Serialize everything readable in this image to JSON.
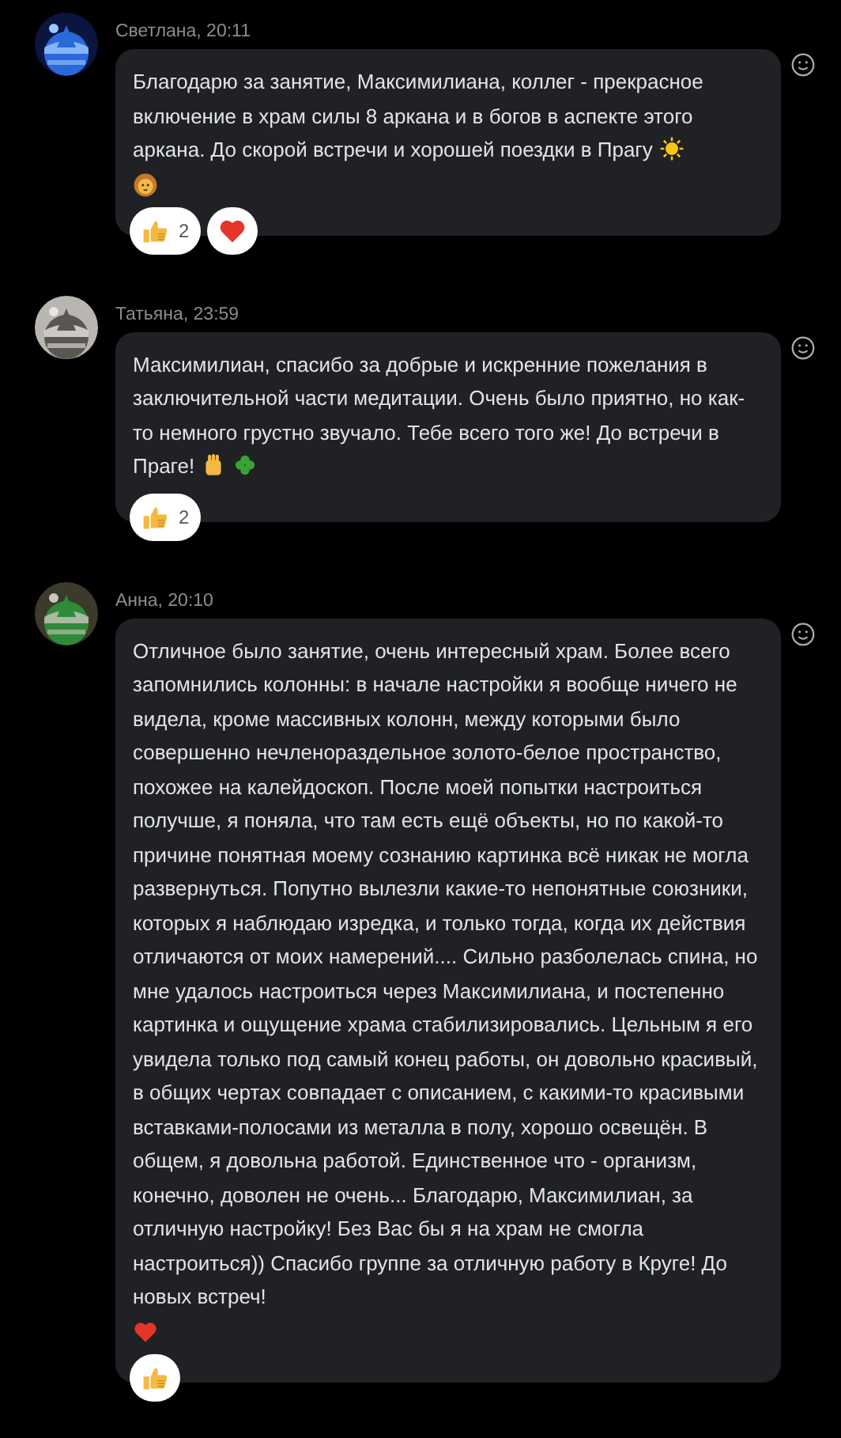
{
  "messages": [
    {
      "author": "Светлана, 20:11",
      "avatar": {
        "kind": "picture"
      },
      "text": "Благодарю за занятие, Максимилиана, коллег - прекрасное включение в храм силы 8 аркана и в богов в аспекте этого аркана. До скорой встречи и хорошей поездки в Прагу",
      "emojis": [
        {
          "kind": "sun"
        },
        {
          "kind": "lion",
          "break": true
        }
      ],
      "reactions": [
        {
          "kind": "thumbs",
          "count": "2"
        },
        {
          "kind": "heart"
        }
      ]
    },
    {
      "author": "Татьяна, 23:59",
      "avatar": {
        "kind": "picture"
      },
      "text": "Максимилиан, спасибо за добрые и искренние пожелания в заключительной части медитации. Очень было приятно, но как-то немного грустно звучало. Тебе всего того же! До встречи в Праге!",
      "emojis": [
        {
          "kind": "fist"
        },
        {
          "kind": "clover"
        }
      ],
      "reactions": [
        {
          "kind": "thumbs",
          "count": "2"
        }
      ]
    },
    {
      "author": "Анна, 20:10",
      "avatar": {
        "kind": "picture"
      },
      "text": "Отличное было занятие, очень интересный храм. Более всего запомнились колонны: в начале настройки я вообще ничего не видела, кроме массивных колонн, между которыми было совершенно нечленораздельное золото-белое пространство, похожее на калейдоскоп. После моей попытки настроиться получше, я поняла, что там есть ещё объекты, но по какой-то причине понятная моему сознанию картинка всё никак не могла развернуться. Попутно вылезли какие-то непонятные союзники, которых я наблюдаю изредка, и только тогда, когда их действия отличаются от моих намерений.... Сильно разболелась спина, но мне удалось настроиться через Максимилиана, и постепенно картинка и ощущение храма стабилизировались. Цельным я его увидела только под самый конец работы, он довольно красивый, в общих чертах совпадает с описанием, с какими-то красивыми вставками-полосами из металла в полу, хорошо освещён. В общем, я довольна работой. Единственное что - организм, конечно, доволен не очень... Благодарю, Максимилиан, за отличную настройку! Без Вас бы я на храм не смогла настроиться)) Спасибо группе за отличную работу в Круге! До новых встреч!",
      "emojis": [
        {
          "kind": "heart",
          "break": true
        }
      ],
      "reactions": [
        {
          "kind": "thumbs"
        }
      ]
    }
  ]
}
